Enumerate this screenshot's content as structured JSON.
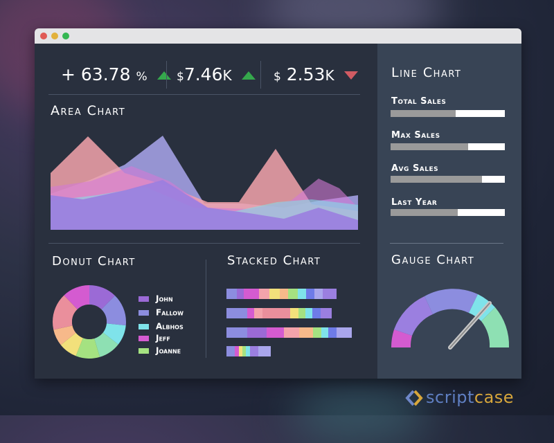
{
  "window": {
    "dots": [
      "#e05a55",
      "#e2b13c",
      "#35b753"
    ]
  },
  "kpis": [
    {
      "prefix": "+",
      "value": "63.78",
      "unit": "%",
      "trend": "up"
    },
    {
      "prefix": "$",
      "value": "7.46",
      "unit": "K",
      "trend": "up"
    },
    {
      "prefix": "$",
      "value": "2.53",
      "unit": "K",
      "trend": "down"
    }
  ],
  "colors": {
    "up": "#35a84c",
    "down": "#d15b63",
    "purple": "#9b7fe0",
    "pink": "#f3a3ab",
    "lavender": "#a9a6ec",
    "magenta": "#d45bd0",
    "cyan": "#7fe3ea",
    "green": "#a5e281"
  },
  "area_chart": {
    "title": "Area Chart"
  },
  "donut_chart": {
    "title": "Donut Chart",
    "legend": [
      {
        "label": "John",
        "color": "#9b6ad6"
      },
      {
        "label": "Fallow",
        "color": "#8c8ddf"
      },
      {
        "label": "Albhos",
        "color": "#7fe3ea"
      },
      {
        "label": "Jeff",
        "color": "#d45bd0"
      },
      {
        "label": "Joanne",
        "color": "#a5e281"
      }
    ]
  },
  "stacked_chart": {
    "title": "Stacked Chart"
  },
  "line_chart": {
    "title": "Line Chart",
    "stats": [
      {
        "label": "Total Sales",
        "value": 0.57
      },
      {
        "label": "Max Sales",
        "value": 0.68
      },
      {
        "label": "Avg Sales",
        "value": 0.8
      },
      {
        "label": "Last Year",
        "value": 0.59
      }
    ]
  },
  "gauge_chart": {
    "title": "Gauge Chart",
    "needle_value": 0.8
  },
  "brand": {
    "part1": "script",
    "part2": "case",
    "icon": "scriptcase-logo-icon"
  }
}
